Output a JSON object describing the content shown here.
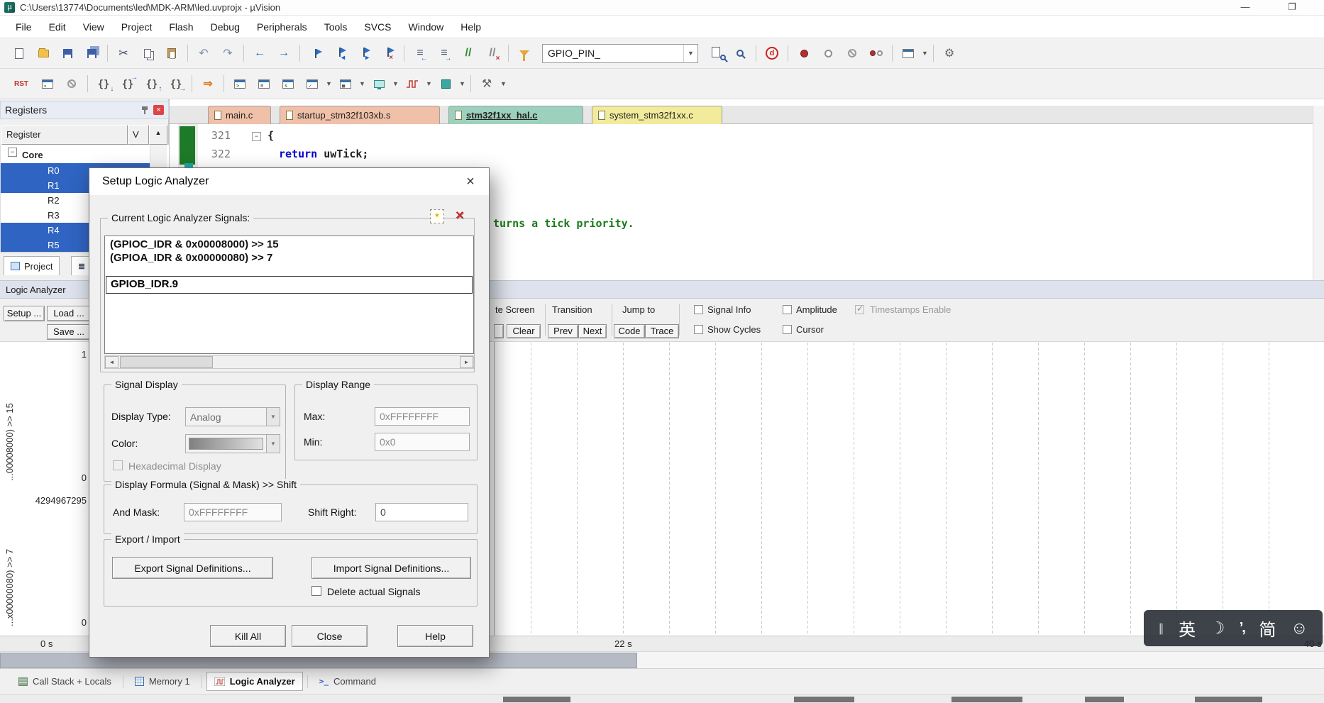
{
  "window": {
    "title": "C:\\Users\\13774\\Documents\\led\\MDK-ARM\\led.uvprojx - µVision",
    "minimize": "—",
    "maximize": "❐"
  },
  "menu": {
    "items": [
      "File",
      "Edit",
      "View",
      "Project",
      "Flash",
      "Debug",
      "Peripherals",
      "Tools",
      "SVCS",
      "Window",
      "Help"
    ]
  },
  "toolbar": {
    "define_combo": "GPIO_PIN_"
  },
  "registers": {
    "title": "Registers",
    "col_register": "Register",
    "col_value": "V",
    "tree_root": "Core",
    "rows": [
      {
        "name": "R0",
        "selected": true
      },
      {
        "name": "R1",
        "selected": true
      },
      {
        "name": "R2",
        "selected": false
      },
      {
        "name": "R3",
        "selected": false
      },
      {
        "name": "R4",
        "selected": true
      },
      {
        "name": "R5",
        "selected": true
      }
    ]
  },
  "panel_tabs": {
    "project": "Project"
  },
  "editor": {
    "tabs": [
      {
        "label": "main.c"
      },
      {
        "label": "startup_stm32f103xb.s"
      },
      {
        "label": "stm32f1xx_hal.c"
      },
      {
        "label": "system_stm32f1xx.c"
      }
    ],
    "line1_num": "321",
    "line1_code": "{",
    "line2_num": "322",
    "line2_kw": "return",
    "line2_rest": " uwTick;",
    "comment_fragment": "turns a tick priority."
  },
  "logic_analyzer": {
    "panel_title": "Logic Analyzer",
    "setup_btn": "Setup ...",
    "load_btn": "Load ...",
    "save_btn": "Save ...",
    "toolbar": {
      "update_screen_fragment": "te Screen",
      "transition": "Transition",
      "jump_to": "Jump to",
      "clear": "Clear",
      "prev": "Prev",
      "next": "Next",
      "code": "Code",
      "trace": "Trace",
      "signal_info": "Signal Info",
      "amplitude": "Amplitude",
      "timestamps": "Timestamps Enable",
      "show_cycles": "Show Cycles",
      "cursor": "Cursor"
    },
    "signal1": {
      "label": "...00008000) >> 15",
      "max": "1",
      "min": "0"
    },
    "signal2": {
      "label": "...x00000080) >> 7",
      "max": "4294967295",
      "min": "0"
    },
    "time_start": "0 s",
    "time_mid": "22 s",
    "time_end": "40 s"
  },
  "dialog": {
    "title": "Setup Logic Analyzer",
    "signals_group": "Current Logic Analyzer Signals:",
    "signal1": "(GPIOC_IDR & 0x00008000) >> 15",
    "signal2": "(GPIOA_IDR & 0x00000080) >> 7",
    "new_signal_value": "GPIOB_IDR.9",
    "signal_display": {
      "legend": "Signal Display",
      "display_type_label": "Display Type:",
      "display_type_value": "Analog",
      "color_label": "Color:",
      "hex_label": "Hexadecimal Display"
    },
    "display_range": {
      "legend": "Display Range",
      "max_label": "Max:",
      "max_value": "0xFFFFFFFF",
      "min_label": "Min:",
      "min_value": "0x0"
    },
    "formula": {
      "legend": "Display Formula (Signal & Mask) >> Shift",
      "and_mask_label": "And Mask:",
      "and_mask_value": "0xFFFFFFFF",
      "shift_label": "Shift Right:",
      "shift_value": "0"
    },
    "export_import": {
      "legend": "Export / Import",
      "export_btn": "Export Signal Definitions...",
      "import_btn": "Import Signal Definitions...",
      "delete_label": "Delete actual Signals"
    },
    "kill_btn": "Kill All",
    "close_btn": "Close",
    "help_btn": "Help"
  },
  "bottom_bar": {
    "tabs": [
      {
        "label": "Call Stack + Locals"
      },
      {
        "label": "Memory 1"
      },
      {
        "label": "Logic Analyzer",
        "active": true
      },
      {
        "label": "Command"
      }
    ]
  },
  "ime": {
    "handle": "∥",
    "lang": "英",
    "moon": "☽",
    "punct": "’,",
    "mode": "简",
    "smiley": "☺"
  },
  "colors": {
    "selection_blue": "#2f64c2",
    "keyword_blue": "#0000cc",
    "comment_green": "#1a7a1a",
    "tab_active_teal": "#9ed1bd",
    "tab_source_pink": "#f0c0a8",
    "tab_yellow": "#f2eb9c",
    "breakpoint_red": "#b03030"
  }
}
